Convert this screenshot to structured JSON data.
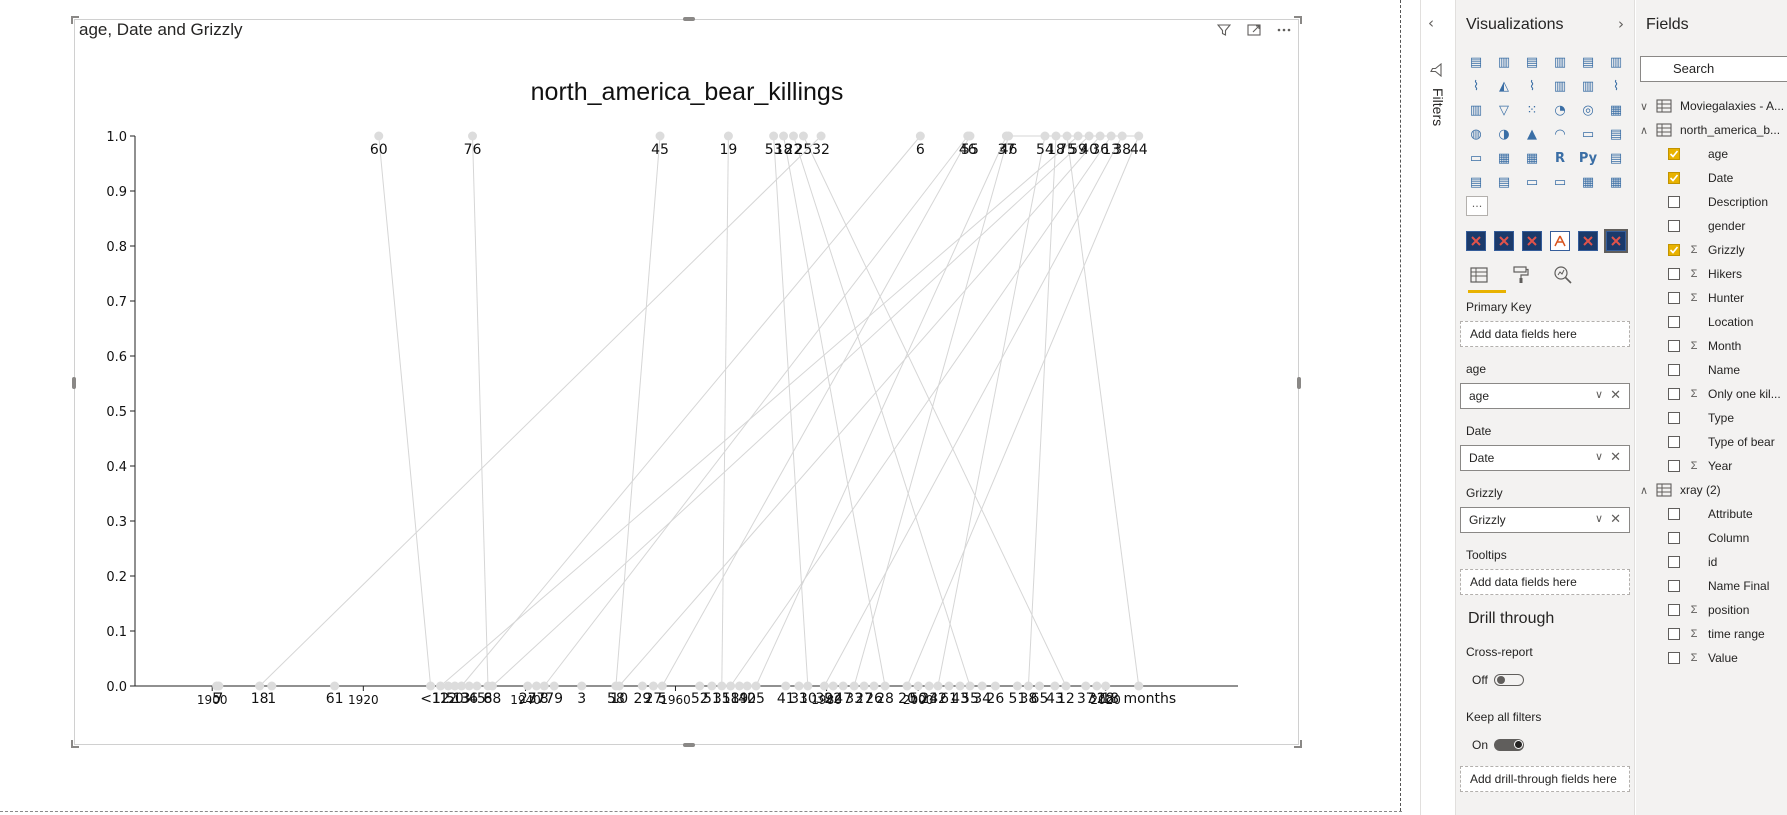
{
  "visual": {
    "title": "age, Date and Grizzly"
  },
  "chart_data": {
    "type": "line",
    "title": "north_america_bear_killings",
    "y_ticks": [
      "0.0",
      "0.1",
      "0.2",
      "0.3",
      "0.4",
      "0.5",
      "0.6",
      "0.7",
      "0.8",
      "0.9",
      "1.0"
    ],
    "ylim": [
      0,
      1.0
    ],
    "x_tick_labels": [
      {
        "text": "1900",
        "pos": 0.07
      },
      {
        "text": "1920",
        "pos": 0.207
      },
      {
        "text": "1940",
        "pos": 0.354
      },
      {
        "text": "1960",
        "pos": 0.49
      },
      {
        "text": "1980",
        "pos": 0.627
      },
      {
        "text": "2000",
        "pos": 0.71
      },
      {
        "text": "2020",
        "pos": 0.88
      }
    ],
    "top_labels": [
      {
        "text": "60",
        "pos": 0.221
      },
      {
        "text": "76",
        "pos": 0.306
      },
      {
        "text": "45",
        "pos": 0.476
      },
      {
        "text": "19",
        "pos": 0.538
      },
      {
        "text": "53",
        "pos": 0.579
      },
      {
        "text": "18",
        "pos": 0.588
      },
      {
        "text": "22",
        "pos": 0.597
      },
      {
        "text": "25",
        "pos": 0.606
      },
      {
        "text": "32",
        "pos": 0.622
      },
      {
        "text": "6",
        "pos": 0.712
      },
      {
        "text": "46",
        "pos": 0.755
      },
      {
        "text": "55",
        "pos": 0.757
      },
      {
        "text": "37",
        "pos": 0.79
      },
      {
        "text": "46",
        "pos": 0.792
      },
      {
        "text": "54",
        "pos": 0.825
      },
      {
        "text": "18",
        "pos": 0.835
      },
      {
        "text": "75",
        "pos": 0.845
      },
      {
        "text": "59",
        "pos": 0.855
      },
      {
        "text": "40",
        "pos": 0.865
      },
      {
        "text": "36",
        "pos": 0.875
      },
      {
        "text": "13",
        "pos": 0.885
      },
      {
        "text": "38",
        "pos": 0.895
      },
      {
        "text": "44",
        "pos": 0.91
      }
    ],
    "bottom_labels": [
      {
        "text": "5",
        "pos": 0.074
      },
      {
        "text": "7",
        "pos": 0.076
      },
      {
        "text": "18",
        "pos": 0.113
      },
      {
        "text": "1",
        "pos": 0.124
      },
      {
        "text": "61",
        "pos": 0.181
      },
      {
        "text": "<1",
        "pos": 0.268
      },
      {
        "text": "12",
        "pos": 0.277
      },
      {
        "text": "12",
        "pos": 0.284
      },
      {
        "text": "50",
        "pos": 0.29
      },
      {
        "text": "13",
        "pos": 0.296
      },
      {
        "text": "36",
        "pos": 0.303
      },
      {
        "text": "45",
        "pos": 0.31
      },
      {
        "text": "8",
        "pos": 0.32
      },
      {
        "text": "68",
        "pos": 0.324
      },
      {
        "text": "27",
        "pos": 0.356
      },
      {
        "text": "37",
        "pos": 0.364
      },
      {
        "text": "8",
        "pos": 0.371
      },
      {
        "text": "79",
        "pos": 0.38
      },
      {
        "text": "3",
        "pos": 0.405
      },
      {
        "text": "58",
        "pos": 0.436
      },
      {
        "text": "10",
        "pos": 0.439
      },
      {
        "text": "29",
        "pos": 0.46
      },
      {
        "text": "27",
        "pos": 0.47
      },
      {
        "text": "5",
        "pos": 0.478
      },
      {
        "text": "52",
        "pos": 0.512
      },
      {
        "text": "51",
        "pos": 0.523
      },
      {
        "text": "31",
        "pos": 0.532
      },
      {
        "text": "58",
        "pos": 0.54
      },
      {
        "text": "19",
        "pos": 0.548
      },
      {
        "text": "40",
        "pos": 0.555
      },
      {
        "text": "25",
        "pos": 0.563
      },
      {
        "text": "41",
        "pos": 0.59
      },
      {
        "text": "31",
        "pos": 0.602
      },
      {
        "text": "30",
        "pos": 0.61
      },
      {
        "text": "39",
        "pos": 0.625
      },
      {
        "text": "22",
        "pos": 0.633
      },
      {
        "text": "47",
        "pos": 0.642
      },
      {
        "text": "33",
        "pos": 0.652
      },
      {
        "text": "27",
        "pos": 0.661
      },
      {
        "text": "26",
        "pos": 0.67
      },
      {
        "text": "28",
        "pos": 0.68
      },
      {
        "text": "20",
        "pos": 0.7
      },
      {
        "text": "50",
        "pos": 0.71
      },
      {
        "text": "24",
        "pos": 0.72
      },
      {
        "text": "32",
        "pos": 0.728
      },
      {
        "text": "61",
        "pos": 0.738
      },
      {
        "text": "43",
        "pos": 0.748
      },
      {
        "text": "55",
        "pos": 0.757
      },
      {
        "text": "34",
        "pos": 0.768
      },
      {
        "text": "26",
        "pos": 0.78
      },
      {
        "text": "51",
        "pos": 0.8
      },
      {
        "text": "38",
        "pos": 0.81
      },
      {
        "text": "65",
        "pos": 0.82
      },
      {
        "text": "43",
        "pos": 0.834
      },
      {
        "text": "12",
        "pos": 0.844
      },
      {
        "text": "37",
        "pos": 0.862
      },
      {
        "text": "31",
        "pos": 0.872
      },
      {
        "text": "28",
        "pos": 0.88
      },
      {
        "text": "18 months",
        "pos": 0.91
      }
    ],
    "grid": false,
    "line_color": "#d6d6d6",
    "point_color": "#dcdcdc"
  },
  "filters_pane": {
    "label": "Filters"
  },
  "visualizations": {
    "title": "Visualizations",
    "more_label": "···",
    "wells": {
      "primary_key": {
        "label": "Primary Key",
        "placeholder": "Add data fields here"
      },
      "age": {
        "label": "age",
        "field": "age"
      },
      "date": {
        "label": "Date",
        "field": "Date"
      },
      "grizzly": {
        "label": "Grizzly",
        "field": "Grizzly"
      },
      "tooltips": {
        "label": "Tooltips",
        "placeholder": "Add data fields here"
      }
    },
    "drill_through": {
      "title": "Drill through",
      "cross_report_label": "Cross-report",
      "cross_report_state": "Off",
      "keep_filters_label": "Keep all filters",
      "keep_filters_state": "On",
      "placeholder": "Add drill-through fields here"
    }
  },
  "fields": {
    "title": "Fields",
    "search_placeholder": "Search",
    "tables": [
      {
        "name": "Moviegalaxies - A..."
      },
      {
        "name": "north_america_b..."
      },
      {
        "name": "xray (2)"
      }
    ],
    "bear_fields": [
      {
        "name": "age",
        "checked": true,
        "sigma": false
      },
      {
        "name": "Date",
        "checked": true,
        "sigma": false
      },
      {
        "name": "Description",
        "checked": false,
        "sigma": false
      },
      {
        "name": "gender",
        "checked": false,
        "sigma": false
      },
      {
        "name": "Grizzly",
        "checked": true,
        "sigma": true
      },
      {
        "name": "Hikers",
        "checked": false,
        "sigma": true
      },
      {
        "name": "Hunter",
        "checked": false,
        "sigma": true
      },
      {
        "name": "Location",
        "checked": false,
        "sigma": false
      },
      {
        "name": "Month",
        "checked": false,
        "sigma": true
      },
      {
        "name": "Name",
        "checked": false,
        "sigma": false
      },
      {
        "name": "Only one kil...",
        "checked": false,
        "sigma": true
      },
      {
        "name": "Type",
        "checked": false,
        "sigma": false
      },
      {
        "name": "Type of bear",
        "checked": false,
        "sigma": false
      },
      {
        "name": "Year",
        "checked": false,
        "sigma": true
      }
    ],
    "xray_fields": [
      {
        "name": "Attribute",
        "checked": false,
        "sigma": false
      },
      {
        "name": "Column",
        "checked": false,
        "sigma": false
      },
      {
        "name": "id",
        "checked": false,
        "sigma": false
      },
      {
        "name": "Name Final",
        "checked": false,
        "sigma": false
      },
      {
        "name": "position",
        "checked": false,
        "sigma": true
      },
      {
        "name": "time range",
        "checked": false,
        "sigma": true
      },
      {
        "name": "Value",
        "checked": false,
        "sigma": true
      }
    ]
  }
}
